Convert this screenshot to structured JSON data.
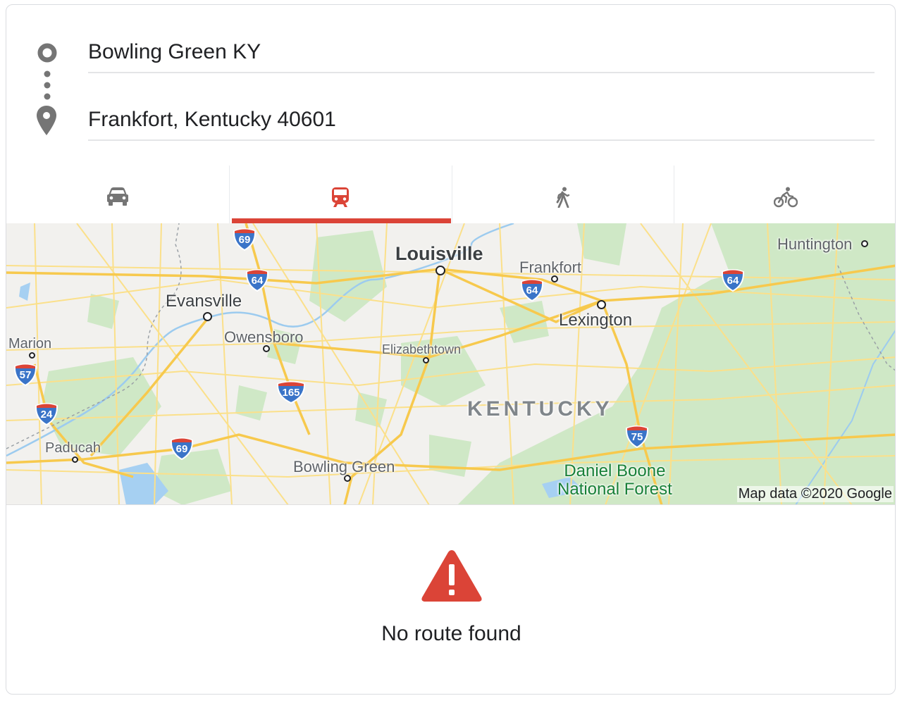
{
  "directions": {
    "origin": "Bowling Green KY",
    "destination": "Frankfort, Kentucky 40601"
  },
  "modes": [
    {
      "name": "driving",
      "icon": "car-icon",
      "active": false
    },
    {
      "name": "transit",
      "icon": "train-icon",
      "active": true
    },
    {
      "name": "walking",
      "icon": "walking-icon",
      "active": false
    },
    {
      "name": "cycling",
      "icon": "bicycle-icon",
      "active": false
    }
  ],
  "colors": {
    "accent": "#db4437",
    "road": "#fad463",
    "interstate": "#3a74c8",
    "forest": "#c8e6c0",
    "icon_gray": "#757575"
  },
  "map": {
    "cities": {
      "louisville": "Louisville",
      "frankfort": "Frankfort",
      "lexington": "Lexington",
      "huntington": "Huntington",
      "evansville": "Evansville",
      "owensboro": "Owensboro",
      "elizabethtown": "Elizabethtown",
      "marion": "Marion",
      "paducah": "Paducah",
      "bowling_green": "Bowling Green"
    },
    "state": "KENTUCKY",
    "forest": {
      "line1": "Daniel Boone",
      "line2": "National Forest"
    },
    "interstates": {
      "i69_north": "69",
      "i64_west": "64",
      "i64_frankfort": "64",
      "i64_east": "64",
      "i57": "57",
      "i24": "24",
      "i165": "165",
      "i69_south": "69",
      "i75": "75"
    },
    "attribution": "Map data ©2020 Google"
  },
  "result": {
    "message": "No route found",
    "icon": "warning-icon"
  }
}
